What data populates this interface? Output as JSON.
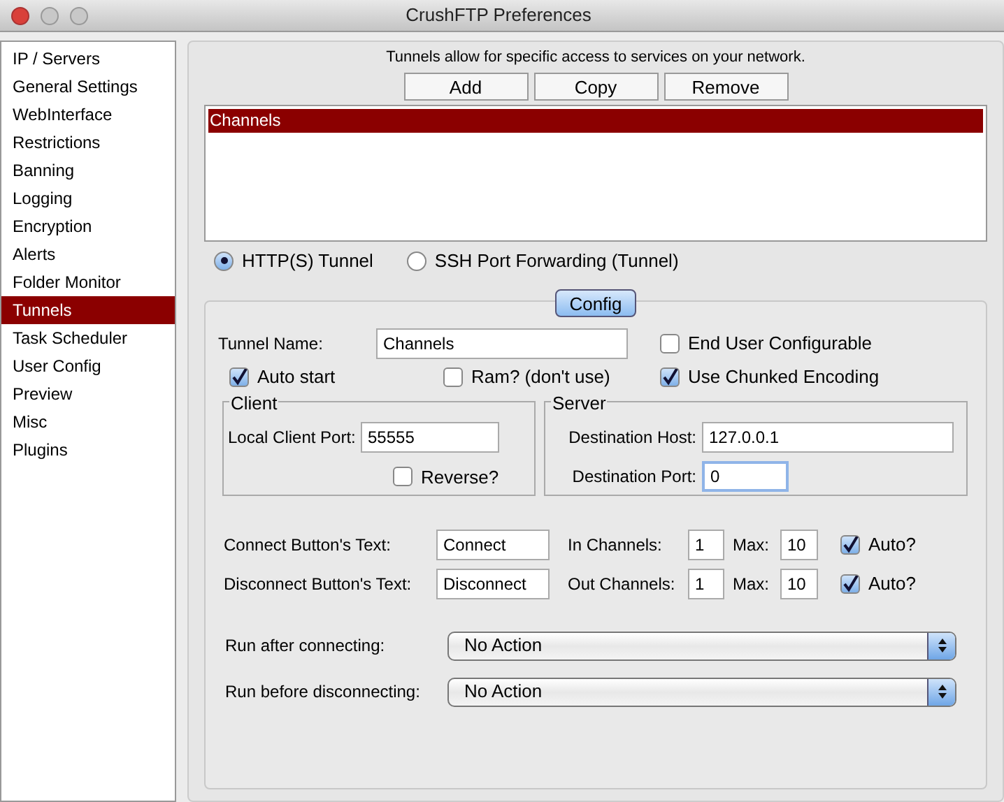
{
  "window": {
    "title": "CrushFTP Preferences"
  },
  "sidebar": {
    "items": [
      {
        "label": "IP / Servers",
        "selected": false
      },
      {
        "label": "General Settings",
        "selected": false
      },
      {
        "label": "WebInterface",
        "selected": false
      },
      {
        "label": "Restrictions",
        "selected": false
      },
      {
        "label": "Banning",
        "selected": false
      },
      {
        "label": "Logging",
        "selected": false
      },
      {
        "label": "Encryption",
        "selected": false
      },
      {
        "label": "Alerts",
        "selected": false
      },
      {
        "label": "Folder Monitor",
        "selected": false
      },
      {
        "label": "Tunnels",
        "selected": true
      },
      {
        "label": "Task Scheduler",
        "selected": false
      },
      {
        "label": "User Config",
        "selected": false
      },
      {
        "label": "Preview",
        "selected": false
      },
      {
        "label": "Misc",
        "selected": false
      },
      {
        "label": "Plugins",
        "selected": false
      }
    ]
  },
  "description": "Tunnels allow for specific access to services on your network.",
  "buttons": [
    "Add",
    "Copy",
    "Remove"
  ],
  "tunnels": [
    {
      "label": "Channels",
      "selected": true
    }
  ],
  "modes": [
    {
      "label": "HTTP(S) Tunnel",
      "selected": true
    },
    {
      "label": "SSH Port Forwarding (Tunnel)",
      "selected": false
    }
  ],
  "config": {
    "tab": "Config",
    "tunnel_name": {
      "label": "Tunnel Name:",
      "value": "Channels"
    },
    "end_user_configurable": {
      "label": "End User Configurable",
      "checked": false
    },
    "auto_start": {
      "label": "Auto start",
      "checked": true
    },
    "ram": {
      "label": "Ram? (don't use)",
      "checked": false
    },
    "chunked": {
      "label": "Use Chunked Encoding",
      "checked": true
    },
    "client": {
      "title": "Client",
      "port_label": "Local Client Port:",
      "port": "55555",
      "reverse": {
        "label": "Reverse?",
        "checked": false
      }
    },
    "server": {
      "title": "Server",
      "host_label": "Destination Host:",
      "host": "127.0.0.1",
      "port_label": "Destination Port:",
      "port": "0"
    },
    "button_rows": [
      {
        "label": "Connect Button's Text:",
        "value": "Connect",
        "channels_label": "In Channels:",
        "channels": "1",
        "max_label": "Max:",
        "max": "10",
        "auto": {
          "label": "Auto?",
          "checked": true
        }
      },
      {
        "label": "Disconnect Button's Text:",
        "value": "Disconnect",
        "channels_label": "Out Channels:",
        "channels": "1",
        "max_label": "Max:",
        "max": "10",
        "auto": {
          "label": "Auto?",
          "checked": true
        }
      }
    ],
    "actions": [
      {
        "label": "Run after connecting:",
        "value": "No Action"
      },
      {
        "label": "Run before disconnecting:",
        "value": "No Action"
      }
    ]
  }
}
